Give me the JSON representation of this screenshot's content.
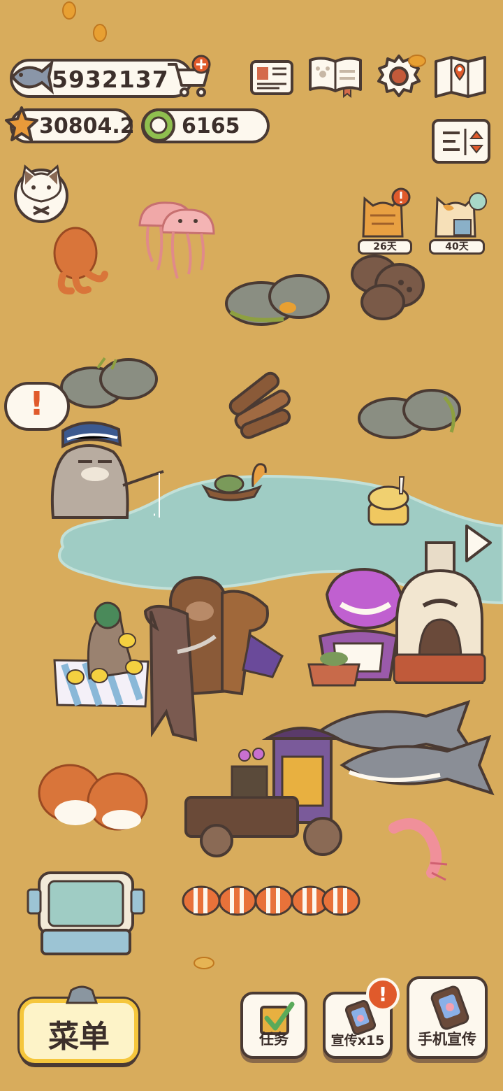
{
  "currency": {
    "fish": "5932137",
    "stars": "30804.2",
    "coins": "6165"
  },
  "guests": [
    {
      "days": "26天"
    },
    {
      "days": "40天"
    }
  ],
  "alert_mark": "!",
  "bottom_bar": {
    "menu_label": "菜单",
    "tasks_label": "任务",
    "promo_label": "宣传x15",
    "phone_promo_label": "手机宣传",
    "promo_badge": "!"
  },
  "icons": {
    "header": [
      "newspaper-icon",
      "paw-book-icon",
      "gear-icon",
      "map-icon"
    ],
    "side": [
      "sort-toggle-icon",
      "arrow-right-icon"
    ]
  },
  "colors": {
    "background": "#d8ac5c",
    "pond": "#9fccc4",
    "outline": "#4a3a33",
    "alert": "#e05a2b",
    "menu_button_fill": "#fdf3c8",
    "menu_button_border": "#f5c63c"
  }
}
